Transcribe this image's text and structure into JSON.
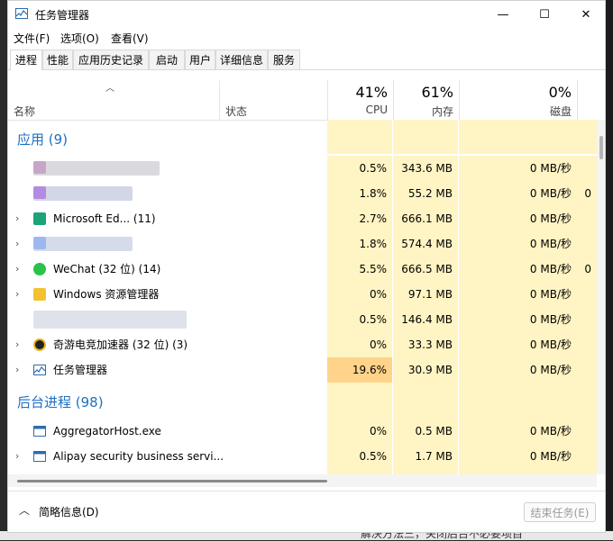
{
  "window": {
    "title": "任务管理器",
    "minimize": "—",
    "maximize": "☐",
    "close": "✕"
  },
  "menu": [
    "文件(F)",
    "选项(O)",
    "查看(V)"
  ],
  "tabs": [
    "进程",
    "性能",
    "应用历史记录",
    "启动",
    "用户",
    "详细信息",
    "服务"
  ],
  "columns": {
    "name": "名称",
    "status": "状态",
    "cpu_pct": "41%",
    "cpu": "CPU",
    "mem_pct": "61%",
    "mem": "内存",
    "disk_pct": "0%",
    "disk": "磁盘"
  },
  "groups": {
    "apps": "应用 (9)",
    "background": "后台进程 (98)"
  },
  "rows": [
    {
      "name": "",
      "cpu": "0.5%",
      "mem": "343.6 MB",
      "disk": "0 MB/秒",
      "net": ""
    },
    {
      "name": "",
      "cpu": "1.8%",
      "mem": "55.2 MB",
      "disk": "0 MB/秒",
      "net": "0"
    },
    {
      "name": "Microsoft Ed... (11)",
      "cpu": "2.7%",
      "mem": "666.1 MB",
      "disk": "0 MB/秒",
      "net": ""
    },
    {
      "name": "",
      "cpu": "1.8%",
      "mem": "574.4 MB",
      "disk": "0 MB/秒",
      "net": ""
    },
    {
      "name": "WeChat (32 位) (14)",
      "cpu": "5.5%",
      "mem": "666.5 MB",
      "disk": "0 MB/秒",
      "net": "0"
    },
    {
      "name": "Windows 资源管理器",
      "cpu": "0%",
      "mem": "97.1 MB",
      "disk": "0 MB/秒",
      "net": ""
    },
    {
      "name": "",
      "cpu": "0.5%",
      "mem": "146.4 MB",
      "disk": "0 MB/秒",
      "net": ""
    },
    {
      "name": "奇游电竞加速器 (32 位) (3)",
      "cpu": "0%",
      "mem": "33.3 MB",
      "disk": "0 MB/秒",
      "net": ""
    },
    {
      "name": "任务管理器",
      "cpu": "19.6%",
      "mem": "30.9 MB",
      "disk": "0 MB/秒",
      "net": ""
    }
  ],
  "bg_rows": [
    {
      "name": "AggregatorHost.exe",
      "cpu": "0%",
      "mem": "0.5 MB",
      "disk": "0 MB/秒"
    },
    {
      "name": "Alipay security business servi...",
      "cpu": "0.5%",
      "mem": "1.7 MB",
      "disk": "0 MB/秒"
    }
  ],
  "footer": {
    "fewer": "简略信息(D)",
    "end_task": "结束任务(E)"
  },
  "background_text": "解决方法三，关闭后台不必要项目",
  "colors": {
    "group_title": "#1f6fc5",
    "cpu_bg": "#fff4c4",
    "cpu_hot": "#ffd48a"
  }
}
